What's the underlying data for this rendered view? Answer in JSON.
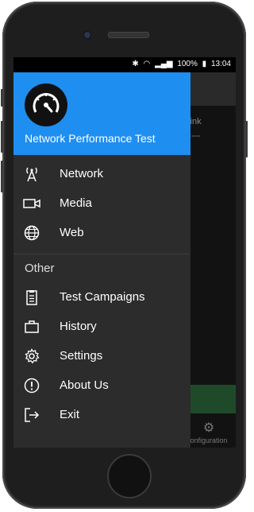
{
  "status_bar": {
    "battery": "100%",
    "time": "13:04"
  },
  "background": {
    "uplink_label": "plink",
    "dash_text": "---",
    "config_label": "onfiguration"
  },
  "drawer": {
    "title": "Network Performance Test",
    "items": [
      {
        "label": "Network",
        "icon": "antenna-icon"
      },
      {
        "label": "Media",
        "icon": "video-camera-icon"
      },
      {
        "label": "Web",
        "icon": "globe-icon"
      }
    ],
    "section_title": "Other",
    "other_items": [
      {
        "label": "Test Campaigns",
        "icon": "clipboard-icon"
      },
      {
        "label": "History",
        "icon": "briefcase-icon"
      },
      {
        "label": "Settings",
        "icon": "gear-icon"
      },
      {
        "label": "About Us",
        "icon": "info-icon"
      },
      {
        "label": "Exit",
        "icon": "exit-icon"
      }
    ]
  }
}
